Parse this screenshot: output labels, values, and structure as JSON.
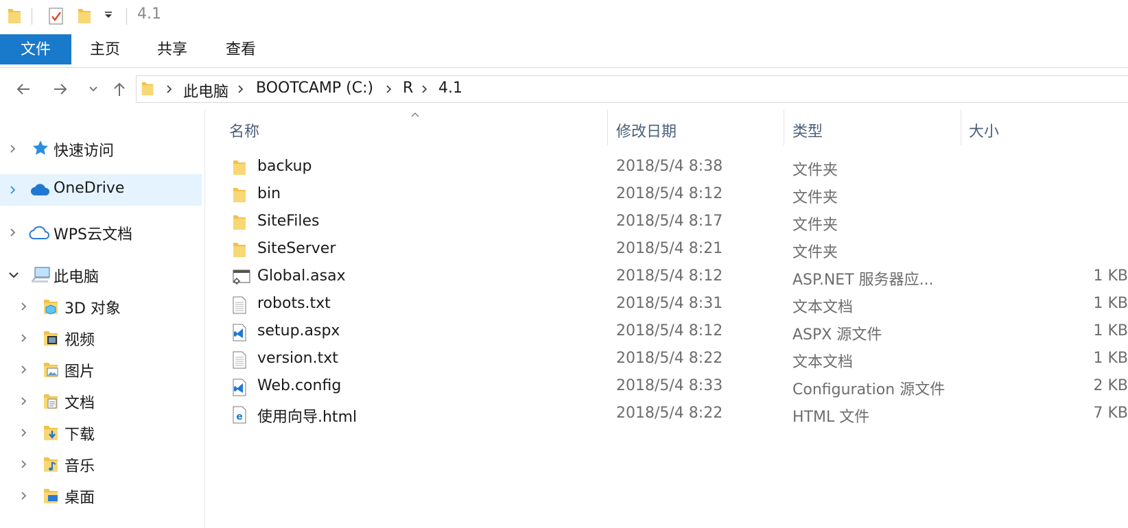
{
  "window": {
    "title": "4.1"
  },
  "ribbon": {
    "tabs": [
      {
        "label": "文件",
        "active": true
      },
      {
        "label": "主页"
      },
      {
        "label": "共享"
      },
      {
        "label": "查看"
      }
    ]
  },
  "address": {
    "crumbs": [
      "此电脑",
      "BOOTCAMP (C:)",
      "R",
      "4.1"
    ]
  },
  "sidebar": {
    "items": [
      {
        "label": "快速访问",
        "icon": "star-icon"
      },
      {
        "label": "OneDrive",
        "icon": "onedrive-cloud-icon",
        "selected": true
      },
      {
        "label": "WPS云文档",
        "icon": "wps-cloud-icon"
      },
      {
        "label": "此电脑",
        "icon": "computer-icon",
        "expanded": true
      },
      {
        "label": "3D 对象",
        "icon": "3d-objects-folder-icon"
      },
      {
        "label": "视频",
        "icon": "videos-folder-icon"
      },
      {
        "label": "图片",
        "icon": "pictures-folder-icon"
      },
      {
        "label": "文档",
        "icon": "documents-folder-icon"
      },
      {
        "label": "下载",
        "icon": "downloads-folder-icon"
      },
      {
        "label": "音乐",
        "icon": "music-folder-icon"
      },
      {
        "label": "桌面",
        "icon": "desktop-folder-icon"
      }
    ]
  },
  "columns": {
    "name": "名称",
    "date": "修改日期",
    "type": "类型",
    "size": "大小"
  },
  "files": [
    {
      "name": "backup",
      "date": "2018/5/4 8:38",
      "type": "文件夹",
      "size": "",
      "icon": "folder-icon"
    },
    {
      "name": "bin",
      "date": "2018/5/4 8:12",
      "type": "文件夹",
      "size": "",
      "icon": "folder-icon"
    },
    {
      "name": "SiteFiles",
      "date": "2018/5/4 8:17",
      "type": "文件夹",
      "size": "",
      "icon": "folder-icon"
    },
    {
      "name": "SiteServer",
      "date": "2018/5/4 8:21",
      "type": "文件夹",
      "size": "",
      "icon": "folder-icon"
    },
    {
      "name": "Global.asax",
      "date": "2018/5/4 8:12",
      "type": "ASP.NET 服务器应...",
      "size": "1 KB",
      "icon": "asax-file-icon"
    },
    {
      "name": "robots.txt",
      "date": "2018/5/4 8:31",
      "type": "文本文档",
      "size": "1 KB",
      "icon": "text-file-icon"
    },
    {
      "name": "setup.aspx",
      "date": "2018/5/4 8:12",
      "type": "ASPX 源文件",
      "size": "1 KB",
      "icon": "vs-file-icon"
    },
    {
      "name": "version.txt",
      "date": "2018/5/4 8:22",
      "type": "文本文档",
      "size": "1 KB",
      "icon": "text-file-icon"
    },
    {
      "name": "Web.config",
      "date": "2018/5/4 8:33",
      "type": "Configuration 源文件",
      "size": "2 KB",
      "icon": "vs-file-icon"
    },
    {
      "name": "使用向导.html",
      "date": "2018/5/4 8:22",
      "type": "HTML 文件",
      "size": "7 KB",
      "icon": "edge-html-file-icon"
    }
  ],
  "colors": {
    "accent": "#1979ca",
    "selected_bg": "#e5f3ff",
    "folder": "#f3c24a",
    "header_text": "#4c607a"
  }
}
